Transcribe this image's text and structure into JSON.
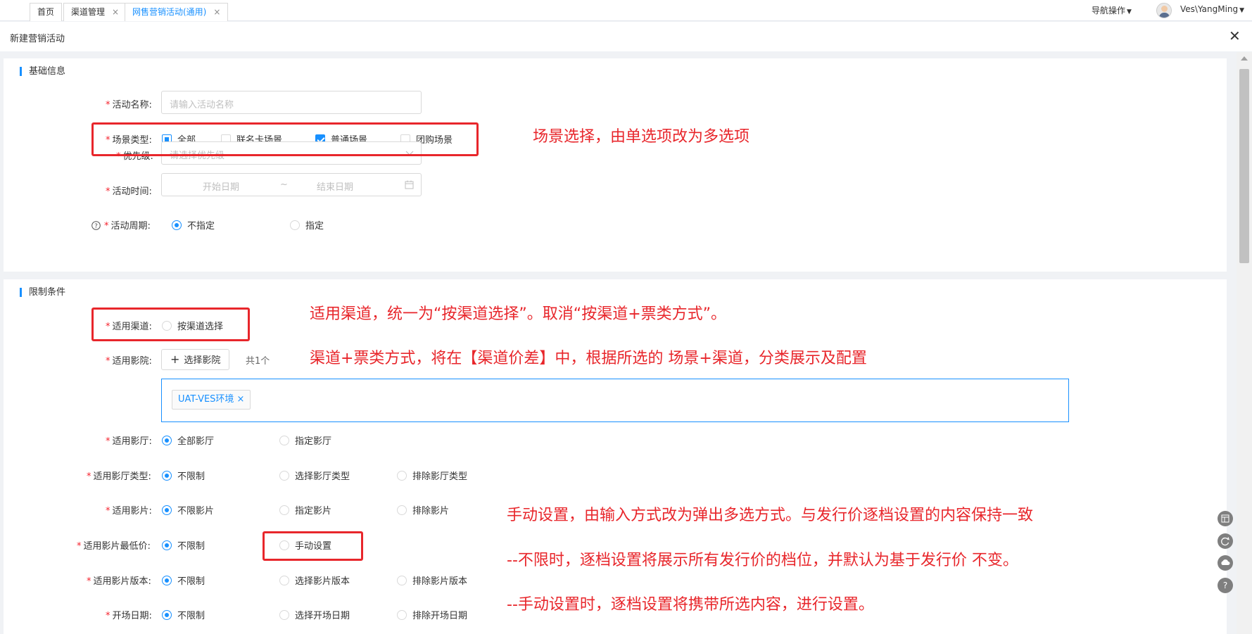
{
  "tabs": [
    {
      "label": "首页",
      "closable": false
    },
    {
      "label": "渠道管理",
      "closable": true
    },
    {
      "label": "网售营销活动(通用)",
      "closable": true,
      "active": true
    }
  ],
  "topbar": {
    "nav_label": "导航操作",
    "user_name": "Ves\\YangMing"
  },
  "dialog": {
    "title": "新建营销活动"
  },
  "basic": {
    "title": "基础信息",
    "name_label": "活动名称:",
    "name_placeholder": "请输入活动名称",
    "scene_label": "场景类型:",
    "scene_options": [
      {
        "label": "全部",
        "state": "partial"
      },
      {
        "label": "联名卡场景",
        "state": "off"
      },
      {
        "label": "普通场景",
        "state": "on"
      },
      {
        "label": "团购场景",
        "state": "off"
      }
    ],
    "priority_label": "优先级:",
    "priority_placeholder": "请选择优先级",
    "time_label": "活动时间:",
    "start_placeholder": "开始日期",
    "date_sep": "~",
    "end_placeholder": "结束日期",
    "cycle_label": "活动周期:",
    "cycle_options": [
      {
        "label": "不指定",
        "selected": true
      },
      {
        "label": "指定",
        "selected": false
      }
    ]
  },
  "limit": {
    "title": "限制条件",
    "channel_label": "适用渠道:",
    "channel_option": "按渠道选择",
    "cinema_label": "适用影院:",
    "cinema_button": "选择影院",
    "cinema_count": "共1个",
    "cinema_tag": "UAT-VES环境",
    "hall_label": "适用影厅:",
    "hall_options": [
      "全部影厅",
      "指定影厅"
    ],
    "hall_type_label": "适用影厅类型:",
    "hall_type_options": [
      "不限制",
      "选择影厅类型",
      "排除影厅类型"
    ],
    "film_label": "适用影片:",
    "film_options": [
      "不限影片",
      "指定影片",
      "排除影片"
    ],
    "min_price_label": "适用影片最低价:",
    "min_price_options": [
      "不限制",
      "手动设置"
    ],
    "version_label": "适用影片版本:",
    "version_options": [
      "不限制",
      "选择影片版本",
      "排除影片版本"
    ],
    "date_label": "开场日期:",
    "date_options": [
      "不限制",
      "选择开场日期",
      "排除开场日期"
    ]
  },
  "annotations": {
    "scene": "场景选择，由单选项改为多选项",
    "channel_1": "适用渠道，统一为“按渠道选择”。取消“按渠道+票类方式”。",
    "channel_2": "渠道+票类方式，将在【渠道价差】中，根据所选的 场景+渠道，分类展示及配置",
    "price_1": "手动设置，由输入方式改为弹出多选方式。与发行价逐档设置的内容保持一致",
    "price_2": "--不限时，逐档设置将展示所有发行价的档位，并默认为基于发行价 不变。",
    "price_3": "--手动设置时，逐档设置将携带所选内容，进行设置。"
  },
  "colors": {
    "accent": "#1890ff",
    "annotation": "#e8262b",
    "required": "#f5222d"
  },
  "icons": [
    "close-icon",
    "chevron-down-icon",
    "calendar-icon",
    "help-icon",
    "plus-icon",
    "avatar",
    "layout-icon",
    "refresh-icon",
    "cloud-icon",
    "question-icon"
  ]
}
